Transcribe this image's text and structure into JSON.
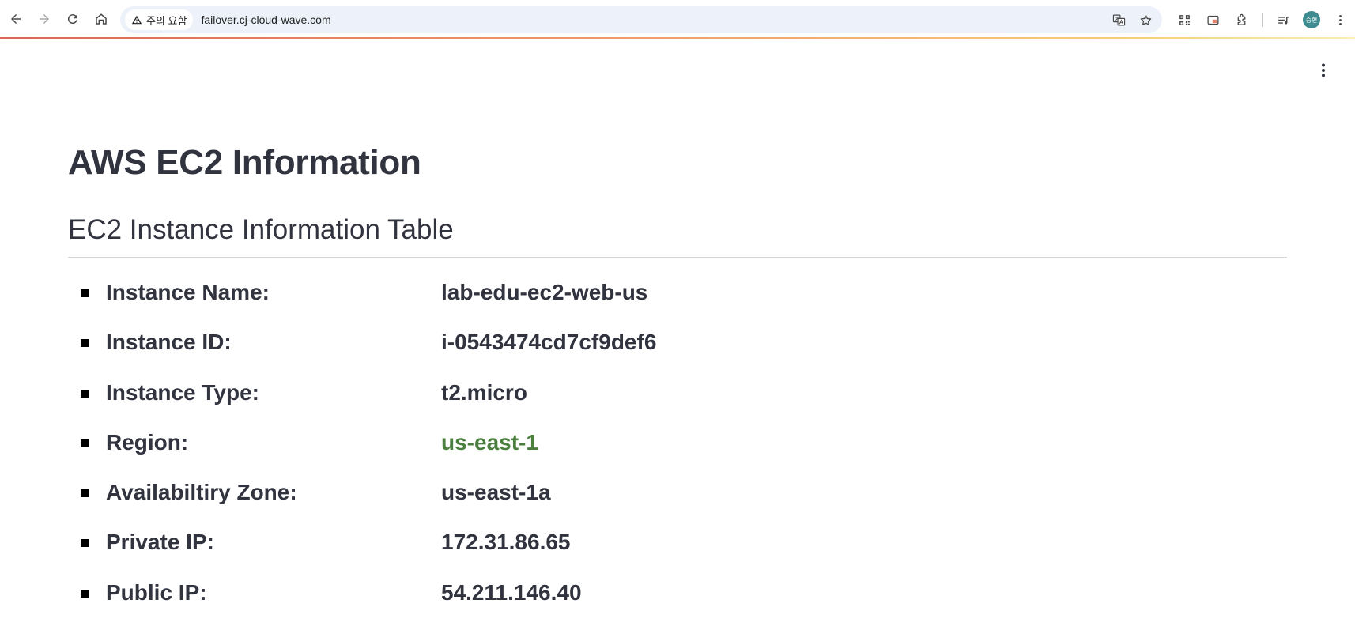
{
  "browser": {
    "security_chip": "주의 요함",
    "url": "failover.cj-cloud-wave.com",
    "profile_initials": "승현"
  },
  "icons": {
    "back": "arrow-left-icon",
    "forward": "arrow-right-icon",
    "reload": "reload-icon",
    "home": "home-icon",
    "warning": "warning-triangle-icon",
    "translate": "translate-icon",
    "bookmark": "star-icon",
    "qr": "qr-code-icon",
    "cast": "cast-icon",
    "extensions": "puzzle-icon",
    "media": "media-controls-icon",
    "menu": "kebab-menu-icon"
  },
  "page": {
    "title": "AWS EC2 Information",
    "section_title": "EC2 Instance Information Table",
    "rows": [
      {
        "label": "Instance Name:",
        "value": "lab-edu-ec2-web-us"
      },
      {
        "label": "Instance ID:",
        "value": "i-0543474cd7cf9def6"
      },
      {
        "label": "Instance Type:",
        "value": "t2.micro"
      },
      {
        "label": "Region:",
        "value": "us-east-1",
        "color": "#4a7f3e"
      },
      {
        "label": "Availabiltiry Zone:",
        "value": "us-east-1a"
      },
      {
        "label": "Private IP:",
        "value": "172.31.86.65"
      },
      {
        "label": "Public IP:",
        "value": "54.211.146.40"
      }
    ]
  },
  "colors": {
    "text": "#31333f",
    "region_value": "#4a7f3e",
    "omnibox_bg": "#edf2fa"
  }
}
